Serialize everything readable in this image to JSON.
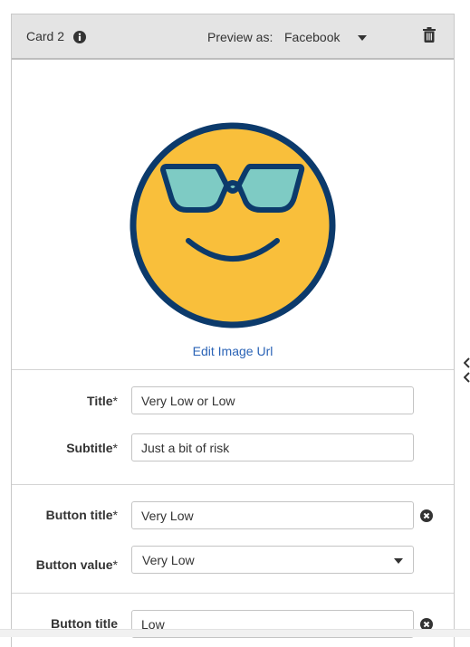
{
  "card": {
    "title": "Card 2",
    "preview_label": "Preview as:",
    "preview_value": "Facebook",
    "edit_image_label": "Edit Image Url"
  },
  "fields": {
    "title_label": "Title",
    "title_value": "Very Low or Low",
    "subtitle_label": "Subtitle",
    "subtitle_value": "Just a bit of risk",
    "required_mark": "*"
  },
  "buttons": [
    {
      "title_label": "Button title",
      "title_value": "Very Low",
      "value_label": "Button value",
      "value_selected": "Very Low"
    },
    {
      "title_label": "Button title",
      "title_value": "Low"
    }
  ],
  "icons": {
    "info": "info-icon",
    "trash": "trash-icon",
    "remove": "remove-circle-icon",
    "image": "sunglasses-smiley"
  },
  "colors": {
    "header_bg": "#e4e4e4",
    "link": "#2a63b6",
    "emoji_face": "#f9bf3b",
    "emoji_outline": "#0c3a6b",
    "lenses": "#7ecbc4"
  }
}
